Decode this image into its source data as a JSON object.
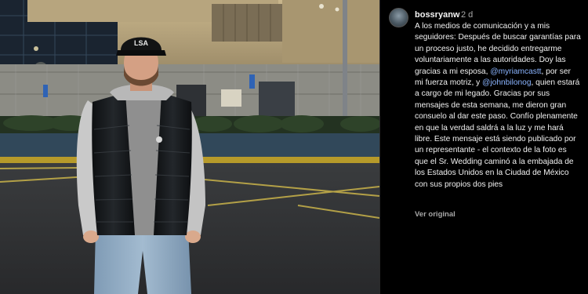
{
  "post": {
    "username": "bossryanw",
    "age": "2 d",
    "caption_parts": [
      {
        "text": "A los medios de comunicación y a mis seguidores: Después de buscar garantías para un proceso justo, he decidido entregarme voluntariamente a las autoridades. Doy las gracias a mi esposa, "
      },
      {
        "text": "@myriamcastt"
      },
      {
        "text": ", por ser mi fuerza motriz, y "
      },
      {
        "text": "@johnbilonog"
      },
      {
        "text": ", quien estará a cargo de mi legado. Gracias por sus mensajes de esta semana, me dieron gran consuelo al dar este paso. Confío plenamente en que la verdad saldrá a la luz y me hará libre. Este mensaje está siendo publicado por un representante - el contexto de la foto es que el Sr. Wedding caminó a la embajada de los Estados Unidos en la Ciudad de México con sus propios dos pies"
      }
    ],
    "see_original": "Ver original",
    "cap_text": "LSA"
  },
  "colors": {
    "background": "#000000",
    "text": "#f2f2f2",
    "muted": "#a8a8a8",
    "mention": "#8ab4ff"
  }
}
